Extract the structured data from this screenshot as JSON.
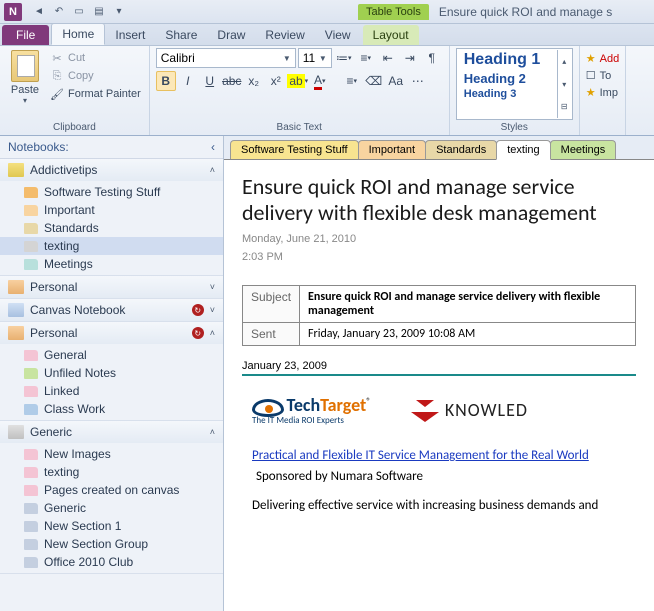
{
  "app_letter": "N",
  "window_title": "Ensure quick ROI and manage s",
  "table_tools": "Table Tools",
  "ribbon": {
    "file": "File",
    "tabs": [
      "Home",
      "Insert",
      "Share",
      "Draw",
      "Review",
      "View"
    ],
    "context_tab": "Layout",
    "active": "Home",
    "clipboard": {
      "label": "Clipboard",
      "paste": "Paste",
      "cut": "Cut",
      "copy": "Copy",
      "fp": "Format Painter"
    },
    "basictext": {
      "label": "Basic Text",
      "font": "Calibri",
      "size": "11"
    },
    "styles": {
      "label": "Styles",
      "h1": "Heading 1",
      "h2": "Heading 2",
      "h3": "Heading 3"
    },
    "extra": {
      "add": "Add",
      "to": "To",
      "imp": "Imp"
    }
  },
  "nav": {
    "header": "Notebooks:",
    "notebooks": [
      {
        "name": "Addictivetips",
        "color": "nb-yellow",
        "expanded": true,
        "sync": false,
        "sections": [
          {
            "name": "Software Testing Stuff",
            "c": "c-orange"
          },
          {
            "name": "Important",
            "c": "c-ltorange"
          },
          {
            "name": "Standards",
            "c": "c-tan"
          },
          {
            "name": "texting",
            "c": "c-gray",
            "active": true
          },
          {
            "name": "Meetings",
            "c": "c-teal"
          }
        ]
      },
      {
        "name": "Personal",
        "color": "nb-peach",
        "expanded": false,
        "sync": false
      },
      {
        "name": "Canvas Notebook",
        "color": "nb-blue",
        "expanded": false,
        "sync": true
      },
      {
        "name": "Personal",
        "color": "nb-peach",
        "expanded": true,
        "sync": true,
        "sections": [
          {
            "name": "General",
            "c": "c-pink"
          },
          {
            "name": "Unfiled Notes",
            "c": "c-green"
          },
          {
            "name": "Linked",
            "c": "c-pink"
          },
          {
            "name": "Class Work",
            "c": "c-blue"
          }
        ]
      },
      {
        "name": "Generic",
        "color": "nb-gray",
        "expanded": true,
        "sync": false,
        "sections": [
          {
            "name": "New Images",
            "c": "c-pink"
          },
          {
            "name": "texting",
            "c": "c-pink"
          },
          {
            "name": "Pages created on canvas",
            "c": "c-pink"
          },
          {
            "name": "Generic",
            "c": "c-grayblue"
          },
          {
            "name": "New Section 1",
            "c": "c-grayblue"
          },
          {
            "name": "New Section Group",
            "c": "c-grayblue"
          },
          {
            "name": "Office 2010 Club",
            "c": "c-grayblue"
          }
        ]
      }
    ]
  },
  "section_tabs": [
    {
      "name": "Software Testing Stuff",
      "c": "c-yellow"
    },
    {
      "name": "Important",
      "c": "c-ltorange"
    },
    {
      "name": "Standards",
      "c": "c-tan"
    },
    {
      "name": "texting",
      "c": "#fff",
      "active": true
    },
    {
      "name": "Meetings",
      "c": "c-green"
    }
  ],
  "page": {
    "title": "Ensure quick ROI and manage service delivery with flexible desk management",
    "date": "Monday, June 21, 2010",
    "time": "2:03 PM",
    "email": {
      "subject_lbl": "Subject",
      "subject": "Ensure quick ROI and manage service delivery with flexible management",
      "sent_lbl": "Sent",
      "sent": "Friday, January 23, 2009 10:08 AM"
    },
    "dateline": "January 23, 2009",
    "tt_tag": "The IT Media ROI Experts",
    "kn_text": "KNOWLED",
    "link": "Practical and Flexible IT Service Management for the Real World",
    "sponsor": "Sponsored by Numara Software",
    "body": "Delivering effective service with increasing business demands and"
  }
}
